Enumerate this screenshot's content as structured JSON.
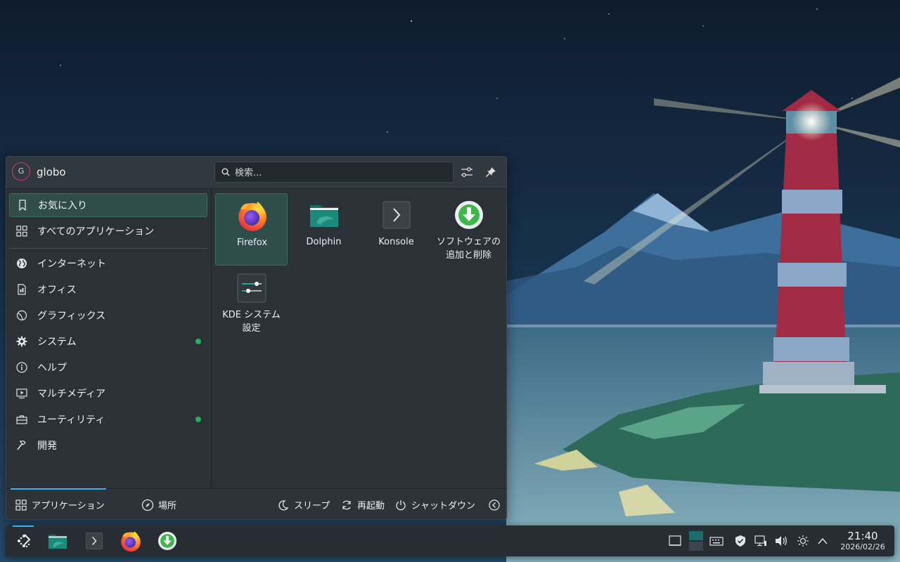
{
  "launcher": {
    "user": {
      "initial": "G",
      "name": "globo"
    },
    "search": {
      "placeholder": "検索..."
    },
    "categories": [
      {
        "label": "お気に入り",
        "icon": "bookmark-icon",
        "active": true
      },
      {
        "label": "すべてのアプリケーション",
        "icon": "app-grid-icon"
      },
      {
        "label": "インターネット",
        "icon": "globe-icon"
      },
      {
        "label": "オフィス",
        "icon": "office-document-icon"
      },
      {
        "label": "グラフィックス",
        "icon": "graphics-icon"
      },
      {
        "label": "システム",
        "icon": "gear-icon",
        "new_badge": true
      },
      {
        "label": "ヘルプ",
        "icon": "info-icon"
      },
      {
        "label": "マルチメディア",
        "icon": "multimedia-icon"
      },
      {
        "label": "ユーティリティ",
        "icon": "toolbox-icon",
        "new_badge": true
      },
      {
        "label": "開発",
        "icon": "hammer-icon"
      }
    ],
    "apps": [
      {
        "name": "Firefox",
        "icon": "firefox-icon",
        "active": true
      },
      {
        "name": "Dolphin",
        "icon": "dolphin-folder-icon"
      },
      {
        "name": "Konsole",
        "icon": "konsole-terminal-icon"
      },
      {
        "name_line1": "ソフトウェアの",
        "name_line2": "追加と削除",
        "icon": "software-install-icon"
      },
      {
        "name_line1": "KDE システム",
        "name_line2": "設定",
        "icon": "system-settings-icon"
      }
    ],
    "footer": {
      "applications": "アプリケーション",
      "places": "場所",
      "sleep": "スリープ",
      "restart": "再起動",
      "shutdown": "シャットダウン"
    }
  },
  "taskbar": {
    "apps": [
      "kickoff-launcher-icon",
      "dolphin-folder-icon",
      "konsole-terminal-icon",
      "firefox-icon",
      "software-install-icon"
    ],
    "tray": [
      "show-desktop-icon",
      "pager-icon",
      "keyboard-icon",
      "shield-icon",
      "network-icon",
      "volume-icon",
      "brightness-icon",
      "expand-tray-icon"
    ],
    "clock": {
      "time": "21:40",
      "date": "2026/02/26"
    }
  },
  "colors": {
    "accent": "#3daee9",
    "highlight": "#2f4d4b",
    "new_badge": "#27ae60",
    "avatar_ring": "#d6337a"
  }
}
